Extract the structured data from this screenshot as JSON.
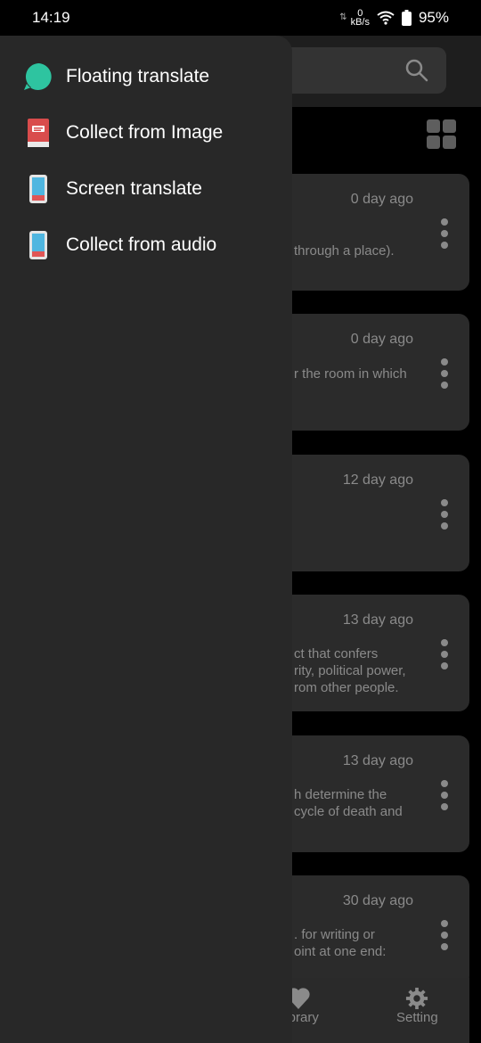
{
  "status": {
    "time": "14:19",
    "net_rate_value": "0",
    "net_rate_unit": "kB/s",
    "battery": "95%"
  },
  "drawer": {
    "items": [
      {
        "label": "Floating translate",
        "icon": "chat-bubble-icon"
      },
      {
        "label": "Collect from Image",
        "icon": "book-icon"
      },
      {
        "label": "Screen translate",
        "icon": "phone-icon"
      },
      {
        "label": "Collect from audio",
        "icon": "phone-icon"
      }
    ]
  },
  "cards": [
    {
      "ago": "0 day ago",
      "snippet": "through a place)."
    },
    {
      "ago": "0 day ago",
      "snippet": "r the room in which"
    },
    {
      "ago": "12 day ago",
      "snippet": ""
    },
    {
      "ago": "13 day ago",
      "snippet": "ct that confers\nrity, political power,\nrom other people."
    },
    {
      "ago": "13 day ago",
      "snippet": "h determine the\ncycle of death and"
    },
    {
      "ago": "30 day ago",
      "snippet": ". for writing or\noint at one end:"
    }
  ],
  "bottom_nav": {
    "library_label": "Library",
    "setting_label": "Setting"
  },
  "colors": {
    "accent": "#2ec4a0",
    "background": "#000000",
    "drawer": "#282828"
  }
}
